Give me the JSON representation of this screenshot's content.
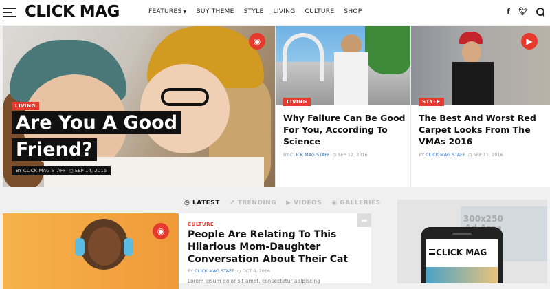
{
  "header": {
    "logo": "CLICK MAG",
    "nav": [
      "FEATURES",
      "BUY THEME",
      "STYLE",
      "LIVING",
      "CULTURE",
      "SHOP"
    ],
    "social": {
      "facebook": "f",
      "twitter": "t"
    }
  },
  "hero": {
    "category": "LIVING",
    "title_line1": "Are You A Good",
    "title_line2": "Friend?",
    "author_prefix": "BY CLICK MAG STAFF",
    "date": "SEP 14, 2016"
  },
  "cards": [
    {
      "category": "LIVING",
      "title": "Why Failure Can Be Good For You, According To Science",
      "by": "BY",
      "author": "CLICK MAG STAFF",
      "date": "SEP 12, 2016"
    },
    {
      "category": "STYLE",
      "title": "The Best And Worst Red Carpet Looks From The VMAs 2016",
      "by": "BY",
      "author": "CLICK MAG STAFF",
      "date": "SEP 11, 2016"
    }
  ],
  "tabs": [
    "LATEST",
    "TRENDING",
    "VIDEOS",
    "GALLERIES"
  ],
  "featured": {
    "category": "CULTURE",
    "title": "People Are Relating To This Hilarious Mom-Daughter Conversation About Their Cat",
    "by": "BY",
    "author": "CLICK MAG STAFF",
    "date": "OCT 6, 2016",
    "excerpt": "Lorem ipsum dolor sit amet, consectetur adipiscing"
  },
  "ad": {
    "line1": "300x250",
    "line2": "Ad Area",
    "phone_logo": "CLICK MAG"
  },
  "colors": {
    "accent": "#e63a2e",
    "link": "#2f6eb8"
  }
}
